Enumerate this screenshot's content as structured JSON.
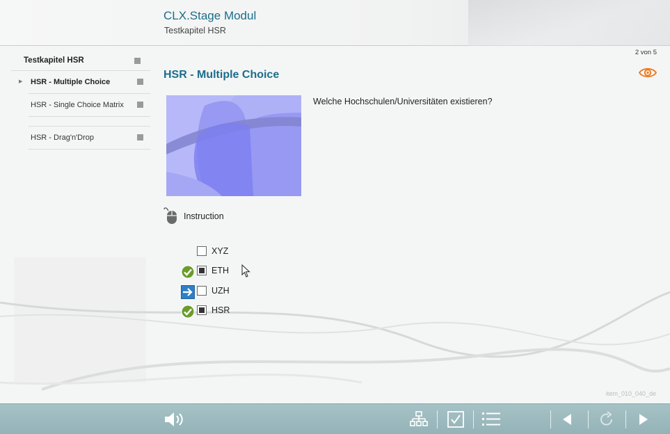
{
  "header": {
    "app_title": "CLX.Stage Modul",
    "chapter_title": "Testkapitel HSR"
  },
  "sidebar": {
    "chapter": "Testkapitel HSR",
    "items": [
      {
        "label": "HSR - Multiple Choice",
        "active": true
      },
      {
        "label": "HSR - Single Choice Matrix",
        "active": false
      },
      {
        "label": "",
        "active": false
      },
      {
        "label": "HSR - Drag'n'Drop",
        "active": false
      }
    ]
  },
  "page_counter": "2 von 5",
  "main": {
    "title": "HSR - Multiple Choice",
    "question": "Welche Hochschulen/Universitäten existieren?",
    "instruction": "Instruction",
    "answers": [
      {
        "label": "XYZ",
        "checked": false,
        "status": "none"
      },
      {
        "label": "ETH",
        "checked": true,
        "status": "correct"
      },
      {
        "label": "UZH",
        "checked": false,
        "status": "arrow"
      },
      {
        "label": "HSR",
        "checked": true,
        "status": "correct"
      }
    ],
    "item_id": "item_010_040_de"
  },
  "toolbar": {
    "icons": [
      "speaker-icon",
      "sitemap-icon",
      "checkbox-icon",
      "list-icon",
      "previous-icon",
      "reload-icon",
      "next-icon"
    ]
  },
  "colors": {
    "accent": "#1b6d8a",
    "eye": "#f07a1f",
    "correct": "#6b9c2c",
    "arrow": "#2f7fc7",
    "toolbar": "#9dbbc0"
  }
}
